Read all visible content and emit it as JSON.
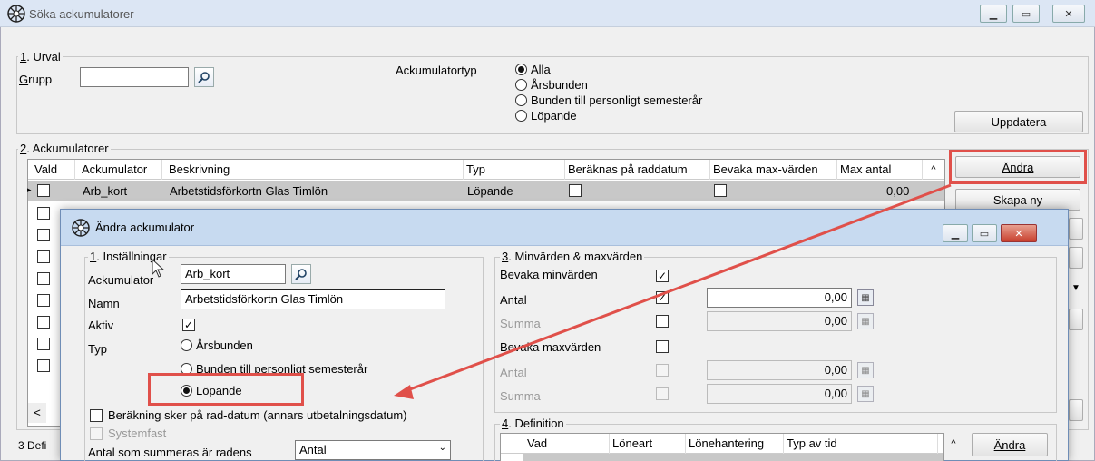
{
  "main_window": {
    "title": "Söka ackumulatorer",
    "urval": {
      "legend": "1. Urval",
      "legend_u": "1",
      "legend_rest": ". Urval",
      "grupp_label_u": "G",
      "grupp_label_rest": "rupp",
      "grupp_value": "",
      "ackumulatortyp_label": "Ackumulatortyp",
      "radio_options": [
        "Alla",
        "Årsbunden",
        "Bunden till personligt semesterår",
        "Löpande"
      ],
      "selected": "Alla",
      "uppdatera_label": "Uppdatera"
    },
    "ackumulatorer": {
      "legend_u": "2",
      "legend_rest": ". Ackumulatorer",
      "columns": [
        "Vald",
        "Ackumulator",
        "Beskrivning",
        "Typ",
        "Beräknas på raddatum",
        "Bevaka max-värden",
        "Max antal"
      ],
      "rows": [
        {
          "ackumulator": "Arb_kort",
          "beskrivning": "Arbetstidsförkortn Glas Timlön",
          "typ": "Löpande",
          "max_antal": "0,00"
        }
      ],
      "andra_label": "Ändra",
      "skapa_ny_label": "Skapa ny",
      "scroll_left": "<"
    },
    "section3_legend": "3 Defi"
  },
  "dialog": {
    "title": "Ändra ackumulator",
    "installningar": {
      "legend_u": "1",
      "legend_rest": ". Inställningar",
      "ackumulator_label": "Ackumulator",
      "ackumulator_value": "Arb_kort",
      "namn_label": "Namn",
      "namn_value": "Arbetstidsförkortn Glas Timlön",
      "aktiv_label": "Aktiv",
      "typ_label": "Typ",
      "typ_options": [
        "Årsbunden",
        "Bunden till personligt semesterår",
        "Löpande"
      ],
      "typ_selected": "Löpande",
      "berakning_label": "Beräkning sker på rad-datum (annars utbetalningsdatum)",
      "systemfast_label": "Systemfast",
      "antal_summeras_label": "Antal som summeras är radens",
      "antal_summeras_value": "Antal"
    },
    "minmax": {
      "legend_u": "3",
      "legend_rest": ". Minvärden  & maxvärden",
      "bevaka_min_label": "Bevaka minvärden",
      "antal_label": "Antal",
      "summa_label": "Summa",
      "bevaka_max_label": "Bevaka maxvärden",
      "min_antal_value": "0,00",
      "min_summa_value": "0,00",
      "max_antal_value": "0,00",
      "max_summa_value": "0,00"
    },
    "definition": {
      "legend_u": "4",
      "legend_rest": ". Definition",
      "columns": [
        "Vad",
        "Löneart",
        "Lönehantering",
        "Typ av tid"
      ],
      "andra_label": "Ändra"
    }
  },
  "colors": {
    "highlight": "#e0504a",
    "selected_row": "#c8c8c8"
  }
}
